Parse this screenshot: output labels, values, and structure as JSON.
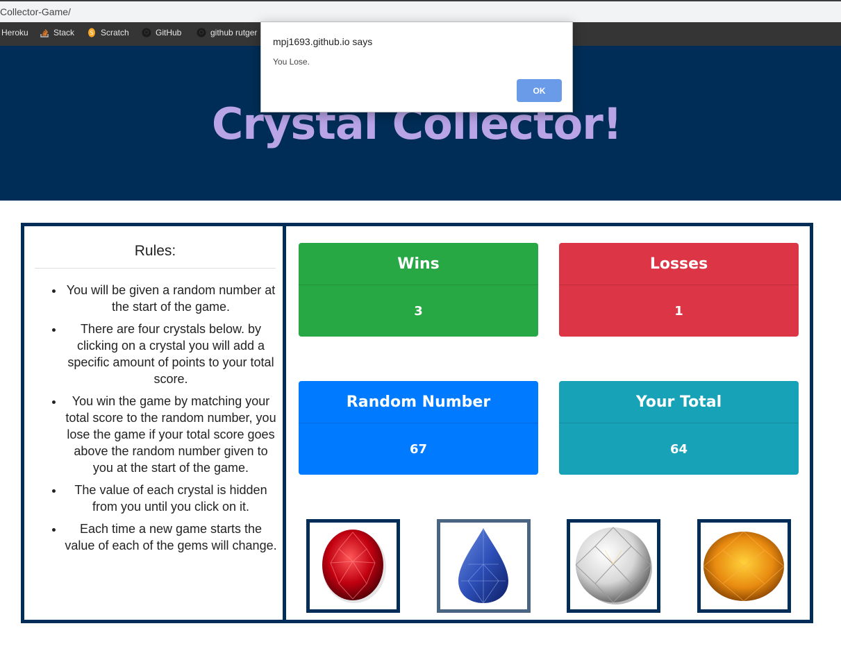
{
  "browser": {
    "url": "Collector-Game/",
    "bookmarks": [
      "Heroku",
      "Stack",
      "Scratch",
      "GitHub",
      "github rutger"
    ]
  },
  "header": {
    "title": "Crystal Collector!"
  },
  "rules": {
    "title": "Rules:",
    "items": [
      "You will be given a random number at the start of the game.",
      "There are four crystals below. by clicking on a crystal you will add a specific amount of points to your total score.",
      "You win the game by matching your total score to the random number, you lose the game if your total score goes above the random number given to you at the start of the game.",
      "The value of each crystal is hidden from you until you click on it.",
      "Each time a new game starts the value of each of the gems will change."
    ]
  },
  "stats": {
    "wins": {
      "label": "Wins",
      "value": "3",
      "color": "#28a745"
    },
    "losses": {
      "label": "Losses",
      "value": "1",
      "color": "#dc3545"
    },
    "random": {
      "label": "Random Number",
      "value": "67",
      "color": "#007bff"
    },
    "total": {
      "label": "Your Total",
      "value": "64",
      "color": "#17a2b8"
    }
  },
  "crystals": [
    "ruby",
    "sapphire",
    "diamond",
    "topaz"
  ],
  "dialog": {
    "title": "mpj1693.github.io says",
    "message": "You Lose.",
    "ok_label": "OK"
  }
}
